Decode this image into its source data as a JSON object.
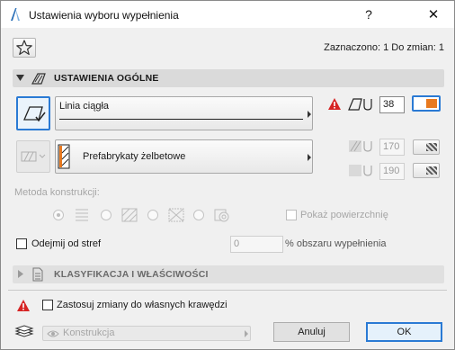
{
  "window": {
    "title": "Ustawienia wyboru wypełnienia",
    "help_label": "?",
    "close_label": "✕"
  },
  "header": {
    "selection_status": "Zaznaczono: 1 Do zmian: 1"
  },
  "general_section": {
    "title": "USTAWIENIA OGÓLNE",
    "line_type": "Linia ciągła",
    "pen_value": "38",
    "building_material": "Prefabrykaty żelbetowe",
    "fg_pen_value": "170",
    "bg_pen_value": "190",
    "construction_method_label": "Metoda konstrukcji:",
    "show_area_label": "Pokaż powierzchnię",
    "subtract_zones_label": "Odejmij od stref",
    "percent_value": "0",
    "percent_label": "% obszaru wypełnienia"
  },
  "classification_section": {
    "title": "KLASYFIKACJA I WŁAŚCIWOŚCI"
  },
  "footer": {
    "apply_edges_label": "Zastosuj zmiany do własnych krawędzi",
    "layer_value": "Konstrukcja",
    "cancel_label": "Anuluj",
    "ok_label": "OK"
  },
  "colors": {
    "accent_orange": "#e8791f",
    "accent_blue": "#2a7ad4",
    "warning_red": "#d62424",
    "section_header": "#dadada"
  }
}
